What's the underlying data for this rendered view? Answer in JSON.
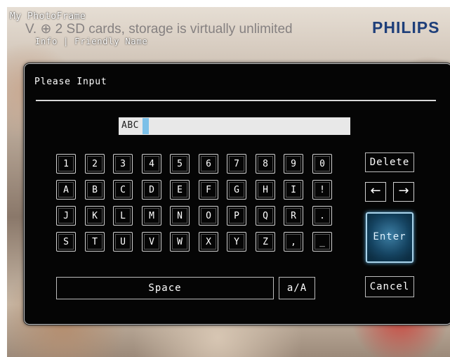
{
  "header": {
    "app_title": "My PhotoFrame",
    "background_caption": "V.  ⊕ 2 SD cards, storage is virtually unlimited",
    "breadcrumb": "Info | Friendly Name",
    "brand": "PHILIPS",
    "brand_color": "#1e3f7a"
  },
  "dialog": {
    "title": "Please Input",
    "input_value": "ABC",
    "caret_color": "#7cc0e8"
  },
  "keyboard": {
    "rows": [
      [
        "1",
        "2",
        "3",
        "4",
        "5",
        "6",
        "7",
        "8",
        "9",
        "0"
      ],
      [
        "A",
        "B",
        "C",
        "D",
        "E",
        "F",
        "G",
        "H",
        "I",
        "!"
      ],
      [
        "J",
        "K",
        "L",
        "M",
        "N",
        "O",
        "P",
        "Q",
        "R",
        "."
      ],
      [
        "S",
        "T",
        "U",
        "V",
        "W",
        "X",
        "Y",
        "Z",
        ",",
        "_"
      ]
    ],
    "space_label": "Space",
    "case_label": "a/A",
    "delete_label": "Delete",
    "left_arrow": "←",
    "right_arrow": "→",
    "enter_label": "Enter",
    "cancel_label": "Cancel",
    "enter_highlight_color": "#a9d3ea"
  }
}
